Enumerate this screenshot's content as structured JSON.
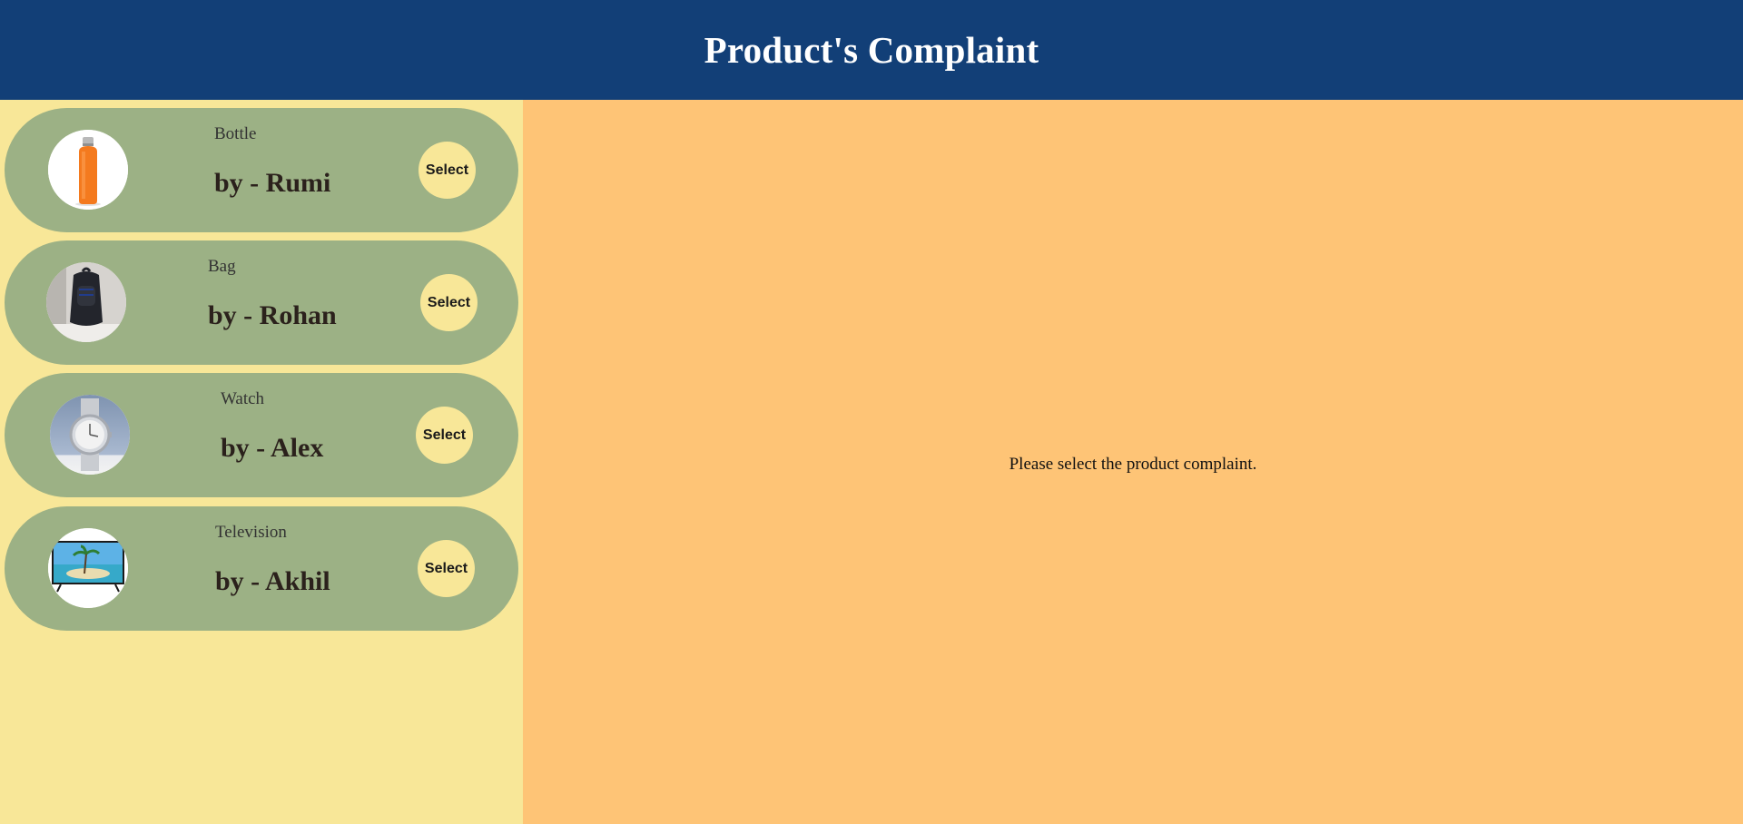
{
  "header": {
    "title": "Product's Complaint"
  },
  "sidebar": {
    "items": [
      {
        "product": "Bottle",
        "author": "by - Rumi",
        "select_label": "Select",
        "icon": "bottle-image"
      },
      {
        "product": "Bag",
        "author": "by - Rohan",
        "select_label": "Select",
        "icon": "backpack-image"
      },
      {
        "product": "Watch",
        "author": "by - Alex",
        "select_label": "Select",
        "icon": "watch-image"
      },
      {
        "product": "Television",
        "author": "by - Akhil",
        "select_label": "Select",
        "icon": "television-image"
      }
    ]
  },
  "main": {
    "message": "Please select the product complaint."
  },
  "colors": {
    "header_bg": "#123f77",
    "sidebar_bg": "#f8e798",
    "main_bg": "#fec476",
    "card_bg": "#9cb185",
    "select_bg": "#f8e798"
  }
}
